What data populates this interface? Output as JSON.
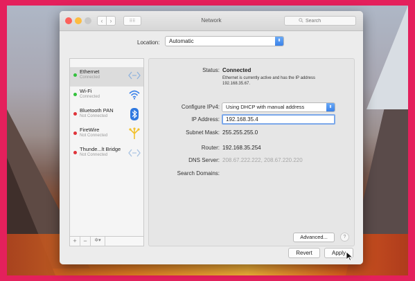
{
  "window": {
    "title": "Network",
    "search_placeholder": "Search",
    "grid_label": "⠿⠿"
  },
  "location": {
    "label": "Location:",
    "value": "Automatic"
  },
  "services": [
    {
      "name": "Ethernet",
      "status": "Connected",
      "status_color": "#34c13d",
      "icon": "ethernet-arrows-icon",
      "selected": true
    },
    {
      "name": "Wi-Fi",
      "status": "Connected",
      "status_color": "#34c13d",
      "icon": "wifi-icon"
    },
    {
      "name": "Bluetooth PAN",
      "status": "Not Connected",
      "status_color": "#e0343a",
      "icon": "bluetooth-icon"
    },
    {
      "name": "FireWire",
      "status": "Not Connected",
      "status_color": "#e0343a",
      "icon": "firewire-icon"
    },
    {
      "name": "Thunde...lt Bridge",
      "status": "Not Connected",
      "status_color": "#e0343a",
      "icon": "thunderbolt-bridge-icon"
    }
  ],
  "sidebar_toolbar": {
    "add": "+",
    "remove": "−",
    "action": "✲▾"
  },
  "detail": {
    "status_label": "Status:",
    "status_value": "Connected",
    "status_desc": "Ethernet is currently active and has the IP address 192.168.35.67.",
    "configure_label": "Configure IPv4:",
    "configure_value": "Using DHCP with manual address",
    "ip_label": "IP Address:",
    "ip_value": "192.168.35.4",
    "subnet_label": "Subnet Mask:",
    "subnet_value": "255.255.255.0",
    "router_label": "Router:",
    "router_value": "192.168.35.254",
    "dns_label": "DNS Server:",
    "dns_value": "208.67.222.222, 208.67.220.220",
    "search_domains_label": "Search Domains:",
    "advanced_label": "Advanced...",
    "help_label": "?"
  },
  "buttons": {
    "revert": "Revert",
    "apply": "Apply"
  },
  "colors": {
    "accent": "#3b82e9",
    "connected": "#34c13d",
    "not_connected": "#e0343a",
    "frame": "#e4205c"
  }
}
